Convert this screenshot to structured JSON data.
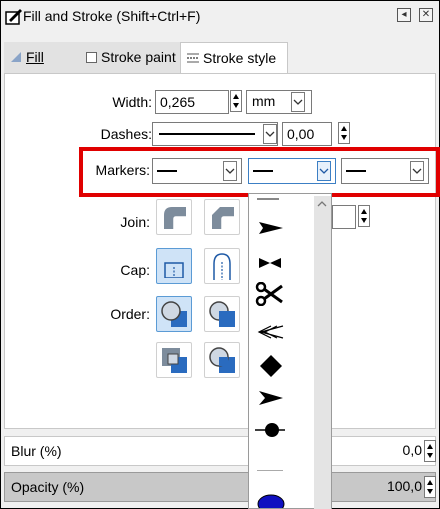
{
  "window": {
    "title": "Fill and Stroke (Shift+Ctrl+F)",
    "buttons": [
      "◂",
      "✕"
    ]
  },
  "tabs": [
    {
      "label": "Fill",
      "active": false,
      "icon": "fill-icon"
    },
    {
      "label": "Stroke paint",
      "active": false,
      "icon": "checkbox-icon"
    },
    {
      "label": "Stroke style",
      "active": true,
      "icon": "stroke-style-icon"
    }
  ],
  "stroke": {
    "width_label": "Width:",
    "width_value": "0,265",
    "unit": "mm",
    "dashes_label": "Dashes:",
    "dash_offset": "0,00",
    "markers_label": "Markers:",
    "join_label": "Join:",
    "cap_label": "Cap:",
    "order_label": "Order:"
  },
  "blur": {
    "label": "Blur (%)",
    "value": "0,0"
  },
  "opacity": {
    "label": "Opacity (%)",
    "value": "100,0"
  },
  "marker_options": [
    "none",
    "arrow",
    "stop",
    "scissors",
    "wedge-arrows",
    "diamond",
    "triangle-arrow",
    "dot",
    "thin-line",
    "ellipse"
  ],
  "colors": {
    "highlight": "#e00000",
    "selected": "#cfe3f7",
    "accent": "#1f5aa6"
  }
}
